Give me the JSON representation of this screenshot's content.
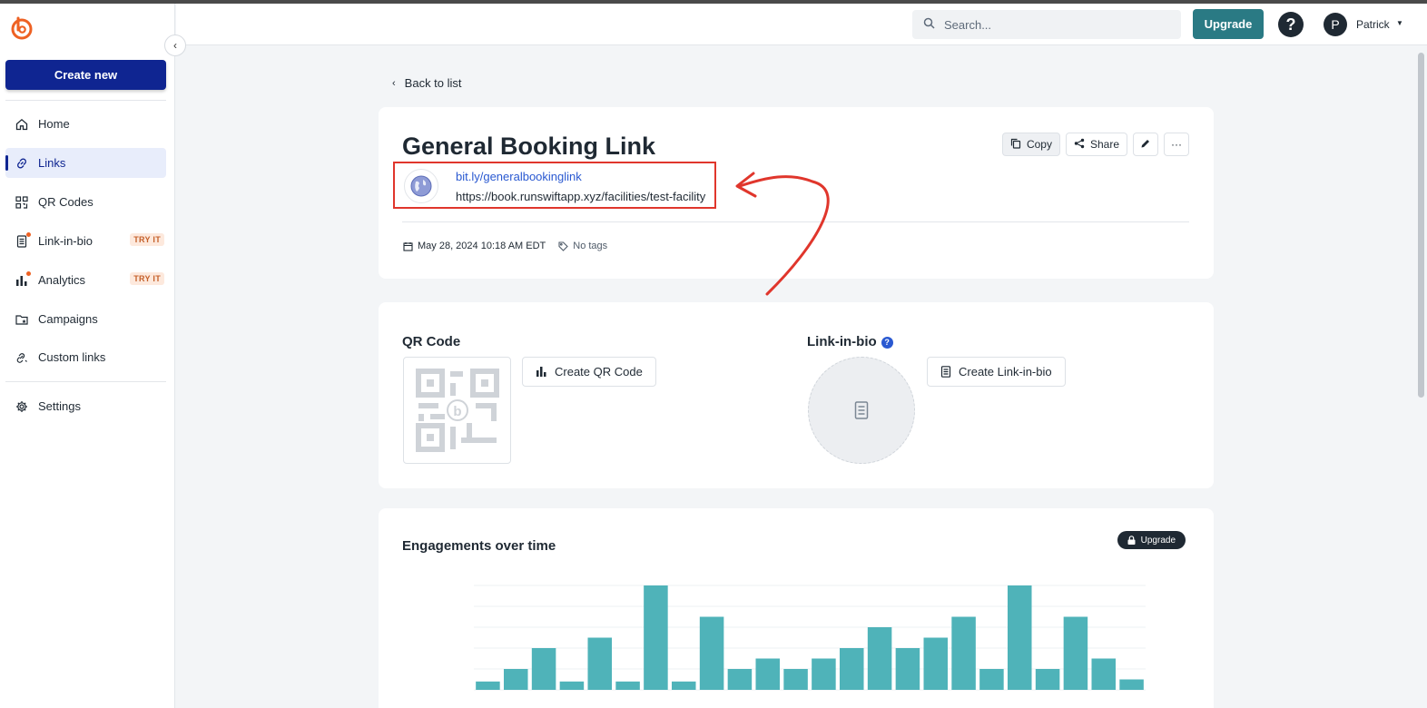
{
  "sidebar": {
    "create_new": "Create new",
    "items": [
      {
        "label": "Home",
        "icon": "home-icon"
      },
      {
        "label": "Links",
        "icon": "link-icon"
      },
      {
        "label": "QR Codes",
        "icon": "qr-icon"
      },
      {
        "label": "Link-in-bio",
        "icon": "page-icon",
        "badge": "TRY IT"
      },
      {
        "label": "Analytics",
        "icon": "bar-chart-icon",
        "badge": "TRY IT"
      },
      {
        "label": "Campaigns",
        "icon": "folder-icon"
      },
      {
        "label": "Custom links",
        "icon": "custom-link-icon"
      },
      {
        "label": "Settings",
        "icon": "gear-icon"
      }
    ]
  },
  "topbar": {
    "search_placeholder": "Search...",
    "upgrade": "Upgrade",
    "help": "?",
    "avatar_initial": "P",
    "user_name": "Patrick"
  },
  "back_label": "Back to list",
  "link": {
    "title": "General Booking Link",
    "short_url": "bit.ly/generalbookinglink",
    "long_url": "https://book.runswiftapp.xyz/facilities/test-facility",
    "created": "May 28, 2024 10:18 AM EDT",
    "tags": "No tags",
    "actions": {
      "copy": "Copy",
      "share": "Share",
      "more": "···"
    }
  },
  "qr": {
    "title": "QR Code",
    "button": "Create QR Code"
  },
  "link_in_bio": {
    "title": "Link-in-bio",
    "button": "Create Link-in-bio"
  },
  "engagements": {
    "title": "Engagements over time",
    "upgrade": "Upgrade"
  },
  "colors": {
    "accent": "#0f2591",
    "teal": "#2a7a84",
    "bar": "#4fb3b9",
    "highlight": "#e0362c",
    "orange": "#ee6123"
  },
  "chart_data": {
    "type": "bar",
    "ylim": [
      0,
      50
    ],
    "values": [
      4,
      10,
      20,
      4,
      25,
      4,
      50,
      4,
      35,
      10,
      15,
      10,
      15,
      20,
      30,
      20,
      25,
      35,
      10,
      50,
      10,
      35,
      15,
      5
    ]
  }
}
